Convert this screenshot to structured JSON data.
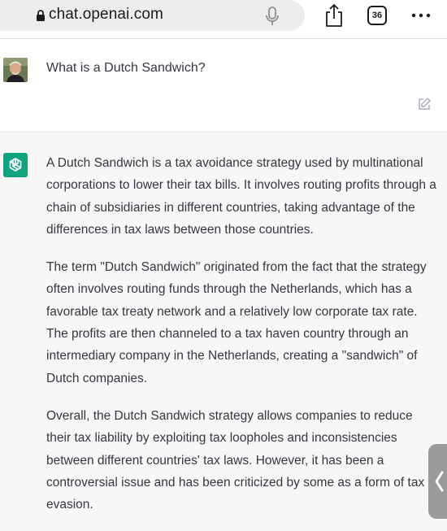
{
  "browser": {
    "url": "chat.openai.com",
    "tab_count": "36",
    "icons": [
      "lock-icon",
      "mic-icon",
      "share-icon",
      "more-icon"
    ]
  },
  "conversation": {
    "user_message": "What is a Dutch Sandwich?",
    "assistant_paragraphs": [
      "A Dutch Sandwich is a tax avoidance strategy used by multinational corporations to lower their tax bills. It involves routing profits through a chain of subsidiaries in different countries, taking advantage of the differences in tax laws between those countries.",
      "The term \"Dutch Sandwich\" originated from the fact that the strategy often involves routing funds through the Netherlands, which has a favorable tax treaty network and a relatively low corporate tax rate. The profits are then channeled to a tax haven country through an intermediary company in the Netherlands, creating a \"sandwich\" of Dutch companies.",
      "Overall, the Dutch Sandwich strategy allows companies to reduce their tax liability by exploiting tax loopholes and inconsistencies between different countries' tax laws. However, it has been a controversial issue and has been criticized by some as a form of tax evasion."
    ]
  },
  "colors": {
    "assistant_bg": "#f7f7f8",
    "brand_green": "#10a37f",
    "text": "#353740"
  }
}
